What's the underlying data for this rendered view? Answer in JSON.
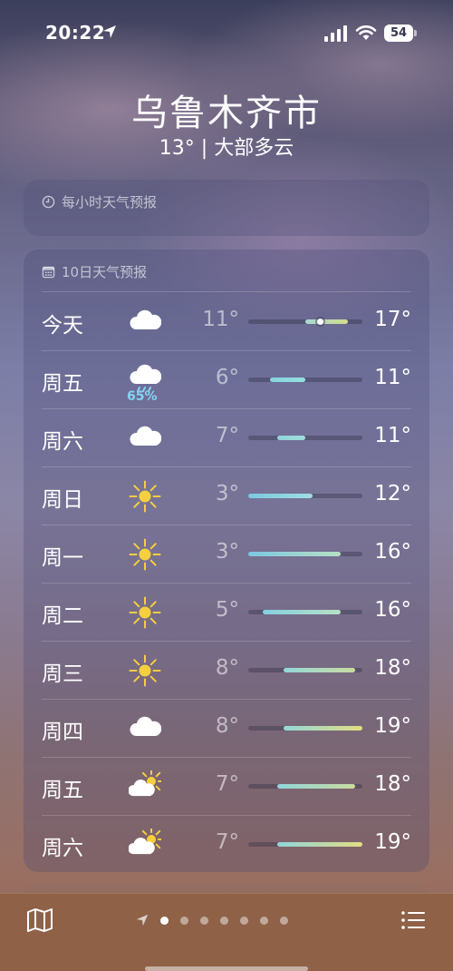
{
  "status": {
    "time": "20:22",
    "battery": "54"
  },
  "location": {
    "city": "乌鲁木齐市",
    "summary": "13° | 大部多云"
  },
  "hourly": {
    "title": "每小时天气预报"
  },
  "forecast": {
    "title": "10日天气预报",
    "days": [
      {
        "day": "今天",
        "icon": "cloud",
        "precip": "",
        "low": "11°",
        "high": "17°",
        "range_min": 3,
        "range_max": 19,
        "current": 13,
        "colors": [
          "#a7d7d4",
          "#d4dc8a"
        ]
      },
      {
        "day": "周五",
        "icon": "rain",
        "precip": "65%",
        "low": "6°",
        "high": "11°",
        "colors": [
          "#85d3e0",
          "#95e0dd"
        ]
      },
      {
        "day": "周六",
        "icon": "cloud",
        "precip": "",
        "low": "7°",
        "high": "11°",
        "colors": [
          "#90d6dc",
          "#a0dcd9"
        ]
      },
      {
        "day": "周日",
        "icon": "sun",
        "precip": "",
        "low": "3°",
        "high": "12°",
        "colors": [
          "#7cc8e0",
          "#9edfe0"
        ]
      },
      {
        "day": "周一",
        "icon": "sun",
        "precip": "",
        "low": "3°",
        "high": "16°",
        "colors": [
          "#7cc8e0",
          "#b7e0c4"
        ]
      },
      {
        "day": "周二",
        "icon": "sun",
        "precip": "",
        "low": "5°",
        "high": "16°",
        "colors": [
          "#85cfe0",
          "#b7e0c4"
        ]
      },
      {
        "day": "周三",
        "icon": "sun",
        "precip": "",
        "low": "8°",
        "high": "18°",
        "colors": [
          "#94d8d8",
          "#cadba0"
        ]
      },
      {
        "day": "周四",
        "icon": "cloud",
        "precip": "",
        "low": "8°",
        "high": "19°",
        "colors": [
          "#94d8d8",
          "#e1dc82"
        ]
      },
      {
        "day": "周五",
        "icon": "partly-sunny",
        "precip": "",
        "low": "7°",
        "high": "18°",
        "colors": [
          "#8fd5da",
          "#cadba0"
        ]
      },
      {
        "day": "周六",
        "icon": "partly-sunny",
        "precip": "",
        "low": "7°",
        "high": "19°",
        "colors": [
          "#8fd5da",
          "#e1dc82"
        ]
      }
    ]
  },
  "pager": {
    "pages": 8,
    "active": 1
  }
}
